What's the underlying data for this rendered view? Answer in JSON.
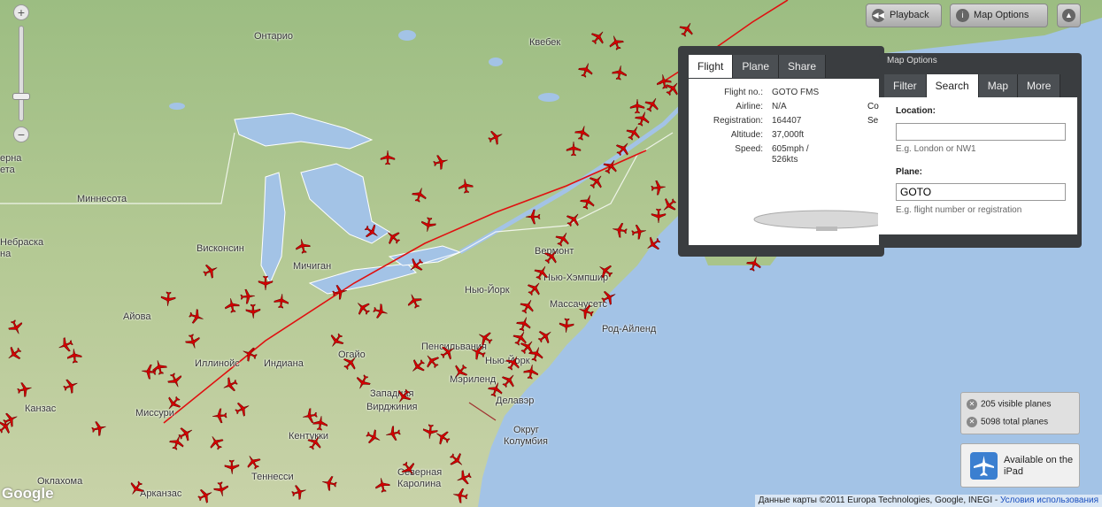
{
  "top_buttons": {
    "playback": "Playback",
    "map_options": "Map Options"
  },
  "map_labels": {
    "ontario": "Онтарио",
    "quebec": "Квебек",
    "minnesota": "Миннесота",
    "wisconsin": "Висконсин",
    "michigan": "Мичиган",
    "iowa": "Айова",
    "illinois": "Иллинойс",
    "indiana": "Индиана",
    "ohio": "Огайо",
    "missouri": "Миссури",
    "kansas": "Канзас",
    "oklahoma": "Оклахома",
    "arkansas": "Арканзас",
    "tennessee": "Теннесси",
    "kentucky": "Кентукки",
    "west_virginia_1": "Западная",
    "west_virginia_2": "Вирджиния",
    "pennsylvania": "Пенсильвания",
    "new_york_state": "Нью-Йорк",
    "vermont": "Вермонт",
    "new_hampshire": "Нью-Хэмпшир",
    "massachusetts": "Массачусетс",
    "rhode_island": "Род-Айленд",
    "new_york_city": "Нью-Йорк",
    "maryland": "Мэриленд",
    "delaware": "Делавэр",
    "dc_1": "Округ",
    "dc_2": "Колумбия",
    "north_carolina_1": "Северная",
    "north_carolina_2": "Каролина",
    "nebraska_partial": "Небраска",
    "edge_1": "ерна",
    "edge_2": "ета",
    "edge_3": "на"
  },
  "flight_panel": {
    "tabs": [
      "Flight",
      "Plane",
      "Share"
    ],
    "rows": [
      {
        "k": "Flight no.:",
        "v": "GOTO FMS"
      },
      {
        "k": "Airline:",
        "v": "N/A"
      },
      {
        "k": "Registration:",
        "v": "164407"
      },
      {
        "k": "Altitude:",
        "v": "37,000ft"
      },
      {
        "k": "Speed:",
        "v": "605mph /"
      },
      {
        "k": "",
        "v": "526kts"
      }
    ],
    "partial_col": [
      "Co",
      "Se"
    ]
  },
  "map_options": {
    "title": "Map Options",
    "tabs": [
      "Filter",
      "Search",
      "Map",
      "More"
    ],
    "location_label": "Location:",
    "location_value": "",
    "location_hint": "E.g. London or NW1",
    "plane_label": "Plane:",
    "plane_value": "GOTO",
    "plane_hint": "E.g. flight number or registration"
  },
  "counts": {
    "visible": "205 visible planes",
    "total": "5098 total planes"
  },
  "ipad": {
    "text": "Available on the iPad"
  },
  "attribution": {
    "text": "Данные карты ©2011 Europa Technologies, Google, INEGI",
    "terms": "Условия использования"
  },
  "google_logo": "Google",
  "colors": {
    "plane": "#d40000",
    "route": "#e01010",
    "water": "#a3c3e6",
    "panel": "#3a3d40"
  }
}
